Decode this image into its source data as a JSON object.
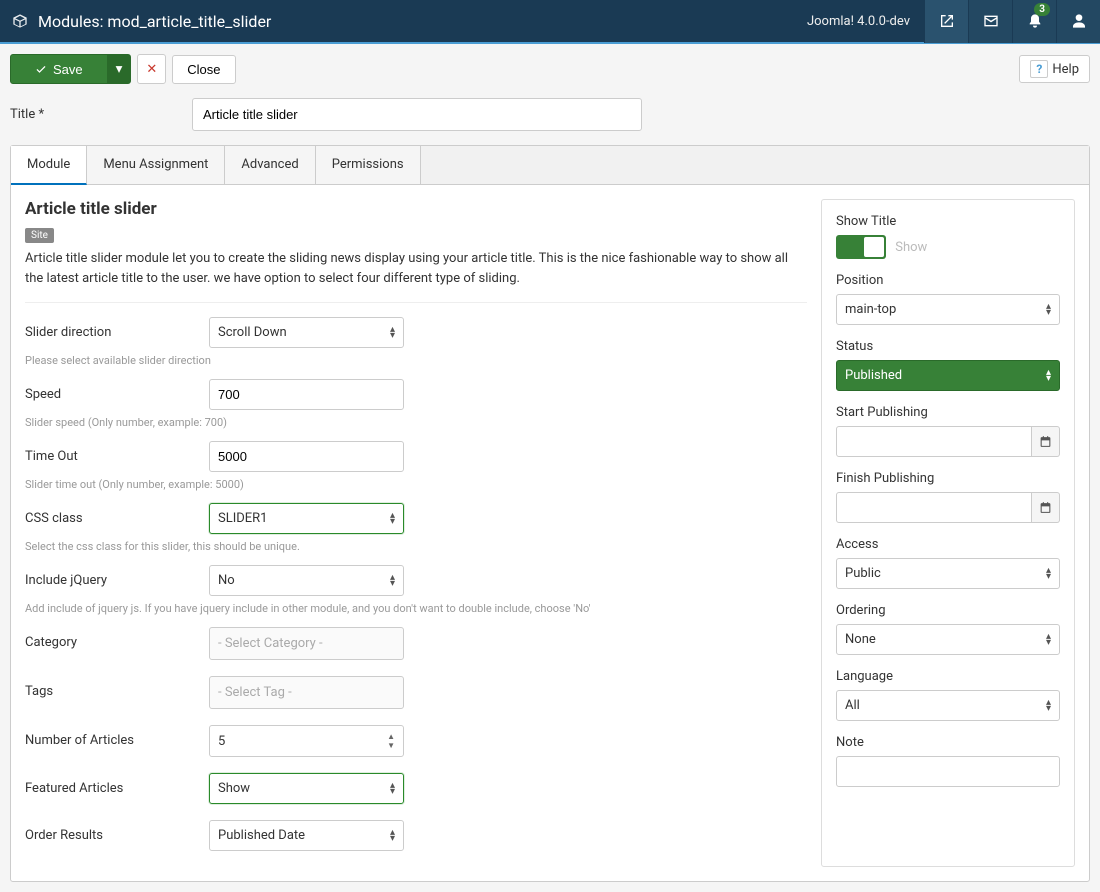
{
  "header": {
    "title": "Modules: mod_article_title_slider",
    "version": "Joomla! 4.0.0-dev",
    "notifications": "3"
  },
  "toolbar": {
    "save": "Save",
    "close": "Close",
    "help": "Help"
  },
  "title_field": {
    "label": "Title *",
    "value": "Article title slider"
  },
  "tabs": {
    "module": "Module",
    "menu_assignment": "Menu Assignment",
    "advanced": "Advanced",
    "permissions": "Permissions"
  },
  "module": {
    "heading": "Article title slider",
    "site_badge": "Site",
    "description": "Article title slider module let you to create the sliding news display using your article title. This is the nice fashionable way to show all the latest article title to the user. we have option to select four different type of sliding.",
    "fields": {
      "slider_direction": {
        "label": "Slider direction",
        "value": "Scroll Down",
        "hint": "Please select available slider direction"
      },
      "speed": {
        "label": "Speed",
        "value": "700",
        "hint": "Slider speed (Only number, example: 700)"
      },
      "timeout": {
        "label": "Time Out",
        "value": "5000",
        "hint": "Slider time out (Only number, example: 5000)"
      },
      "css_class": {
        "label": "CSS class",
        "value": "SLIDER1",
        "hint": "Select the css class for this slider, this should be unique."
      },
      "include_jquery": {
        "label": "Include jQuery",
        "value": "No",
        "hint": "Add include of jquery js. If you have jquery include in other module, and you don't want to double include, choose 'No'"
      },
      "category": {
        "label": "Category",
        "placeholder": "- Select Category -"
      },
      "tags": {
        "label": "Tags",
        "placeholder": "- Select Tag -"
      },
      "num_articles": {
        "label": "Number of Articles",
        "value": "5"
      },
      "featured": {
        "label": "Featured Articles",
        "value": "Show"
      },
      "order": {
        "label": "Order Results",
        "value": "Published Date"
      }
    }
  },
  "sidebar": {
    "show_title": {
      "label": "Show Title",
      "state_label": "Show"
    },
    "position": {
      "label": "Position",
      "value": "main-top"
    },
    "status": {
      "label": "Status",
      "value": "Published"
    },
    "start_publishing": {
      "label": "Start Publishing",
      "value": ""
    },
    "finish_publishing": {
      "label": "Finish Publishing",
      "value": ""
    },
    "access": {
      "label": "Access",
      "value": "Public"
    },
    "ordering": {
      "label": "Ordering",
      "value": "None"
    },
    "language": {
      "label": "Language",
      "value": "All"
    },
    "note": {
      "label": "Note",
      "value": ""
    }
  }
}
